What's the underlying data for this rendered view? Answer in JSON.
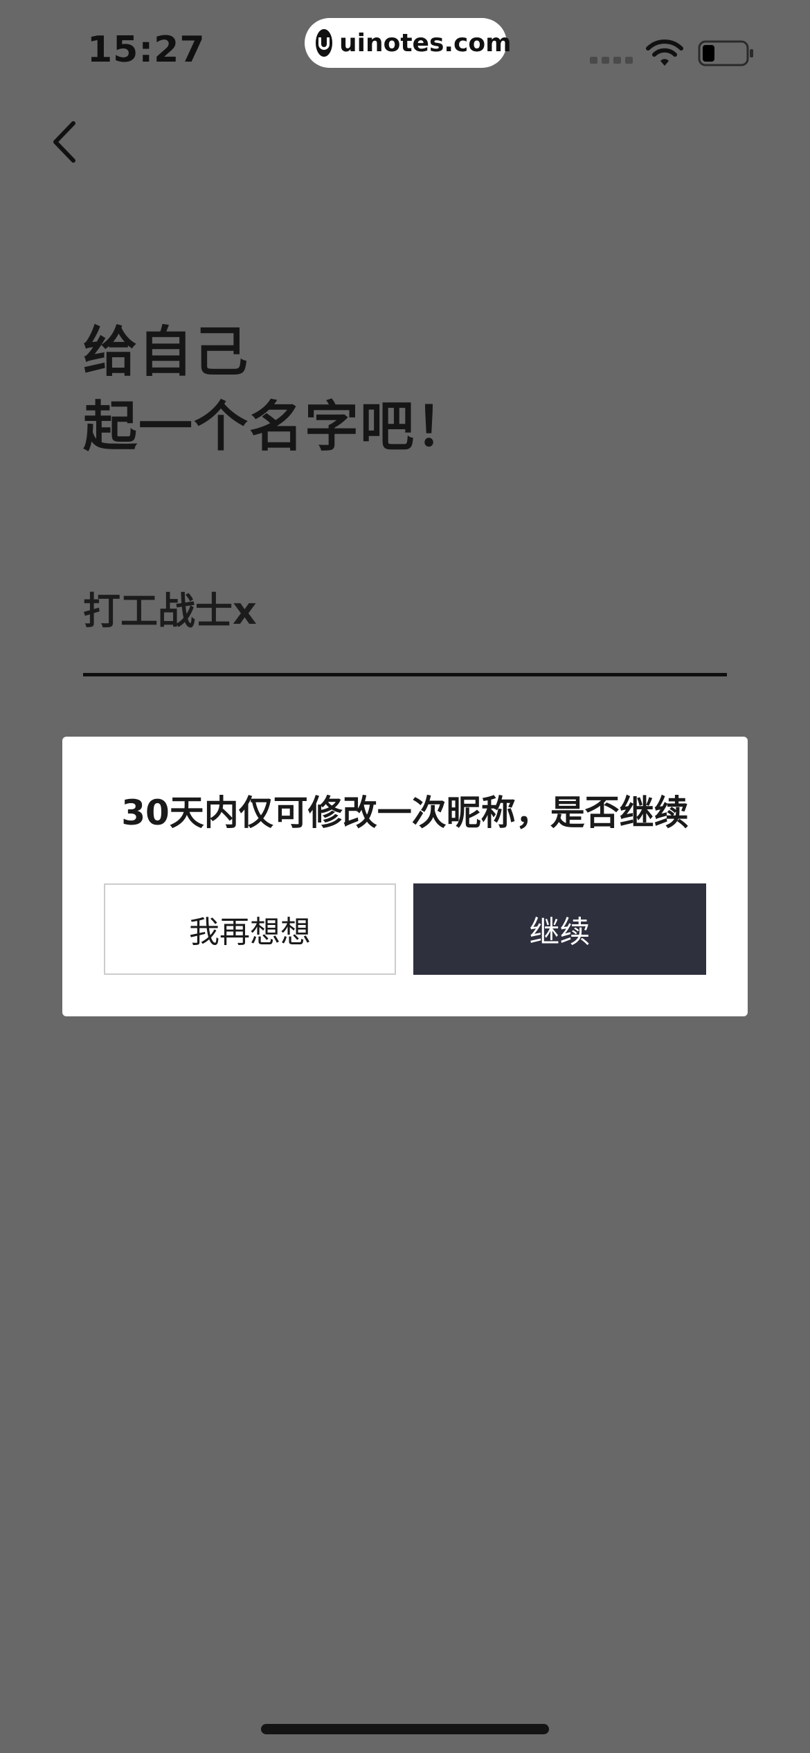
{
  "status_bar": {
    "time": "15:27",
    "watermark": "uinotes.com",
    "icons": [
      "signal-icon",
      "wifi-icon",
      "battery-icon"
    ]
  },
  "nav": {
    "back_icon": "chevron-left-icon"
  },
  "title": {
    "line1": "给自己",
    "line2": "起一个名字吧！"
  },
  "nickname": {
    "value": "打工战士x"
  },
  "dialog": {
    "message": "30天内仅可修改一次昵称，是否继续",
    "cancel_label": "我再想想",
    "continue_label": "继续"
  },
  "colors": {
    "overlay_background": "#686868",
    "dialog_background": "#ffffff",
    "primary_button": "#2e303e",
    "text_dark": "#1a1a1a"
  }
}
